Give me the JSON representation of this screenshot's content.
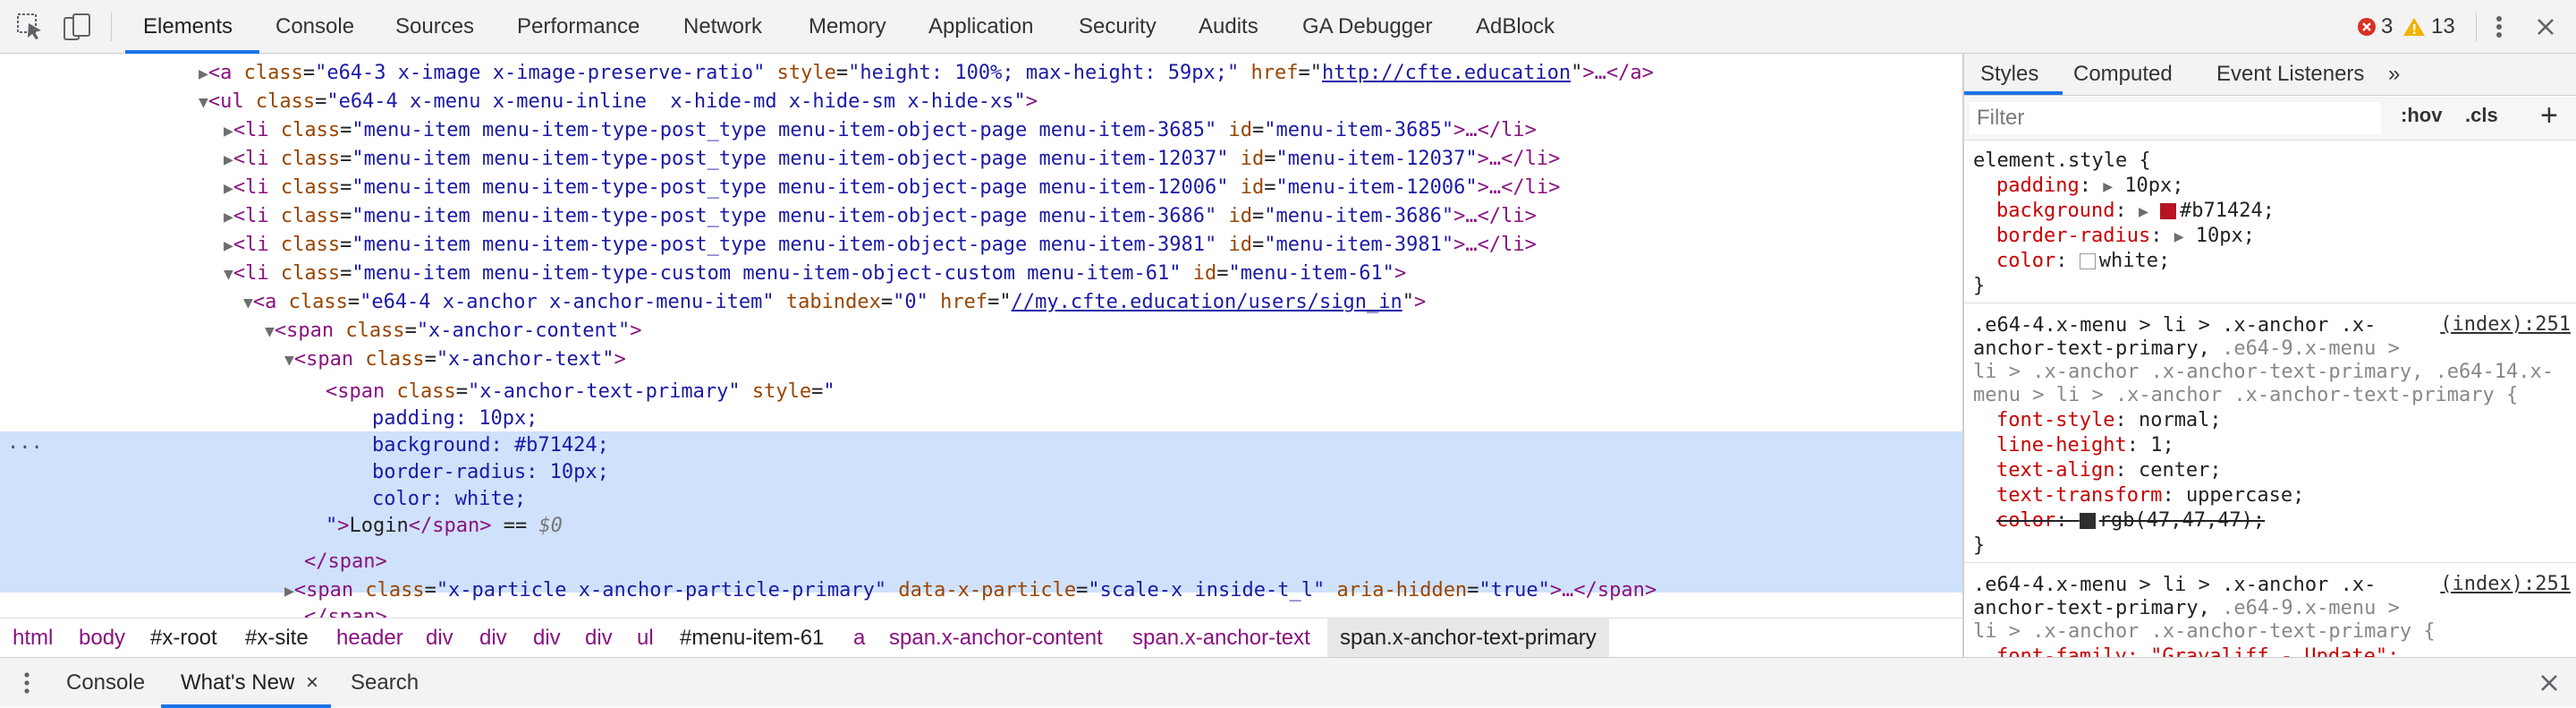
{
  "toolbar": {
    "tabs": [
      "Elements",
      "Console",
      "Sources",
      "Performance",
      "Network",
      "Memory",
      "Application",
      "Security",
      "Audits",
      "GA Debugger",
      "AdBlock"
    ],
    "error_count": "3",
    "warning_count": "13"
  },
  "dom": {
    "lines": [
      {
        "indent": 0,
        "html": "…"
      },
      {
        "l1_tag": "<a",
        "l1_attr1": "class",
        "l1_val1": "\"e64-3 x-image x-image-preserve-ratio\"",
        "l1_attr2": "style",
        "l1_val2": "\"height: 100%; max-height: 59px;\"",
        "l1_attr3": "href",
        "l1_link": "http://cfte.education",
        "l1_end": ">…</a>"
      }
    ],
    "a1": {
      "tag": "<a",
      "c": "class",
      "cv": "\"e64-3 x-image x-image-preserve-ratio\"",
      "s": "style",
      "sv": "\"height: 100%; max-height: 59px;\"",
      "h": "href",
      "hv": "http://cfte.education",
      "end": ">…</a>"
    },
    "ul": {
      "tag": "<ul",
      "c": "class",
      "cv": "\"e64-4 x-menu x-menu-inline  x-hide-md x-hide-sm x-hide-xs\"",
      "end": ">"
    },
    "li_items": [
      {
        "cv": "\"menu-item menu-item-type-post_type menu-item-object-page menu-item-3685\"",
        "iv": "\"menu-item-3685\""
      },
      {
        "cv": "\"menu-item menu-item-type-post_type menu-item-object-page menu-item-12037\"",
        "iv": "\"menu-item-12037\""
      },
      {
        "cv": "\"menu-item menu-item-type-post_type menu-item-object-page menu-item-12006\"",
        "iv": "\"menu-item-12006\""
      },
      {
        "cv": "\"menu-item menu-item-type-post_type menu-item-object-page menu-item-3686\"",
        "iv": "\"menu-item-3686\""
      },
      {
        "cv": "\"menu-item menu-item-type-post_type menu-item-object-page menu-item-3981\"",
        "iv": "\"menu-item-3981\""
      }
    ],
    "li_tag": "<li",
    "li_class": "class",
    "li_id": "id",
    "li_end": ">…</li>",
    "li61": {
      "cv": "\"menu-item menu-item-type-custom menu-item-object-custom menu-item-61\"",
      "iv": "\"menu-item-61\"",
      "end": ">"
    },
    "a2": {
      "tag": "<a",
      "c": "class",
      "cv": "\"e64-4 x-anchor x-anchor-menu-item\"",
      "t": "tabindex",
      "tv": "\"0\"",
      "h": "href",
      "hv": "//my.cfte.education/users/sign_in",
      "end": ">"
    },
    "span_content": {
      "tag": "<span",
      "c": "class",
      "cv": "\"x-anchor-content\"",
      "end": ">"
    },
    "span_text": {
      "tag": "<span",
      "c": "class",
      "cv": "\"x-anchor-text\"",
      "end": ">"
    },
    "span_primary": {
      "tag": "<span",
      "c": "class",
      "cv": "\"x-anchor-text-primary\"",
      "s": "style",
      "sv_open": "\""
    },
    "style_lines": [
      "padding: 10px;",
      "background: #b71424;",
      "border-radius: 10px;",
      "color: white;"
    ],
    "primary_close": {
      "q": "\"",
      "gt": ">",
      "text": "Login",
      "endtag": "</span>",
      "eq": " == ",
      "dollar": "$0"
    },
    "span_close": "</span>",
    "particle": {
      "tag": "<span",
      "c": "class",
      "cv": "\"x-particle x-anchor-particle-primary\"",
      "d": "data-x-particle",
      "dv": "\"scale-x inside-t_l\"",
      "a": "aria-hidden",
      "av": "\"true\"",
      "end": ">…</span>"
    },
    "last_close": "</span>",
    "ellipsis": "..."
  },
  "breadcrumb": [
    "html",
    "body",
    "#x-root",
    "#x-site",
    "header",
    "div",
    "div",
    "div",
    "div",
    "ul",
    "#menu-item-61",
    "a",
    "span.x-anchor-content",
    "span.x-anchor-text",
    "span.x-anchor-text-primary"
  ],
  "styles": {
    "tabs": [
      "Styles",
      "Computed",
      "Event Listeners",
      "»"
    ],
    "filter_placeholder": "Filter",
    "hov": ":hov",
    "cls": ".cls",
    "add": "+",
    "element_style": {
      "selector": "element.style {",
      "props": [
        {
          "name": "padding",
          "value": "10px;"
        },
        {
          "name": "background",
          "value": "#b71424;"
        },
        {
          "name": "border-radius",
          "value": "10px;"
        },
        {
          "name": "color",
          "value": "white;"
        }
      ],
      "close": "}"
    },
    "rule1": {
      "source": "(index):251",
      "sel_lines": [
        ".e64-4.x-menu > li > .x-anchor .x-",
        "anchor-text-primary, ",
        ".e64-9.x-menu >",
        "li > .x-anchor .x-anchor-text-primary, ",
        ".e64-14.x-",
        "menu > li > .x-anchor .x-anchor-text-primary {"
      ],
      "props": [
        {
          "name": "font-style",
          "value": "normal;"
        },
        {
          "name": "line-height",
          "value": "1;"
        },
        {
          "name": "text-align",
          "value": "center;"
        },
        {
          "name": "text-transform",
          "value": "uppercase;"
        }
      ],
      "struck": {
        "name": "color",
        "value": "rgb(47,47,47);"
      },
      "close": "}"
    },
    "rule2": {
      "source": "(index):251",
      "sel_lines": [
        ".e64-4.x-menu > li > .x-anchor .x-",
        "anchor-text-primary, ",
        ".e64-9.x-menu >",
        "li > .x-anchor .x-anchor-text-primary {"
      ],
      "partial": "font-family: \"Gravaliff - Update\";"
    },
    "colors": {
      "background_swatch": "#b71424",
      "white_swatch": "#ffffff",
      "struck_swatch": "#2f2f2f"
    }
  },
  "drawer": {
    "tabs": [
      "Console",
      "What's New",
      "Search"
    ],
    "close_tab": "×"
  }
}
